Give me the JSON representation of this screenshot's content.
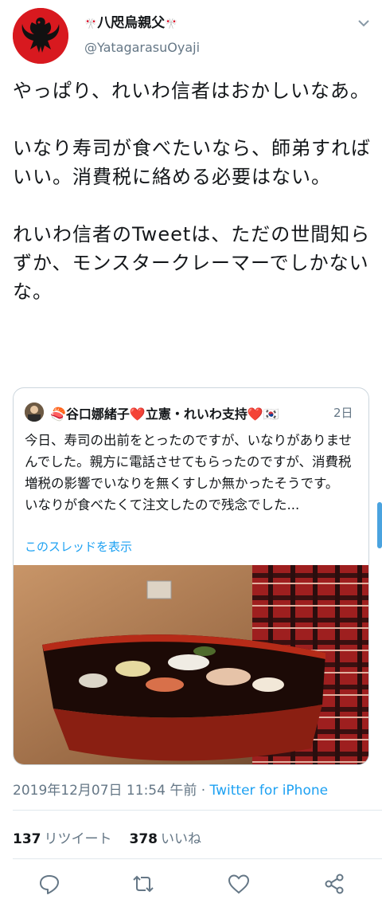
{
  "author": {
    "display_name": "八咫烏親父",
    "flag_left": "🎌",
    "flag_right": "🎌",
    "handle": "@YatagarasuOyaji",
    "avatar_icon": "yatagarasu-crow-logo"
  },
  "tweet": {
    "text": "やっぱり、れいわ信者はおかしいなあ。\n\nいなり寿司が食べたいなら、師弟すればいい。消費税に絡める必要はない。\n\nれいわ信者のTweetは、ただの世間知らずか、モンスタークレーマーでしかないな。"
  },
  "quoted_tweet": {
    "name": "🍣谷口娜緒子❤️立憲・れいわ支持❤️🇰🇷",
    "time": "2日",
    "text": "今日、寿司の出前をとったのですが、いなりがありませんでした。親方に電話させてもらったのですが、消費税増税の影響でいなりを無くすしか無かったそうです。\nいなりが食べたくて注文したので残念でした...",
    "thread_link": "このスレッドを表示",
    "image_icon": "sushi-bowl-photo"
  },
  "meta": {
    "timestamp": "2019年12月07日 11:54 午前",
    "separator": "·",
    "source": "Twitter for iPhone"
  },
  "stats": {
    "retweets": "137",
    "retweets_label": "リツイート",
    "likes": "378",
    "likes_label": "いいね"
  },
  "colors": {
    "accent": "#1da1f2",
    "secondary_text": "#657786",
    "avatar_red": "#d8191f"
  },
  "actions": [
    "reply-icon",
    "retweet-icon",
    "like-icon",
    "share-icon"
  ]
}
